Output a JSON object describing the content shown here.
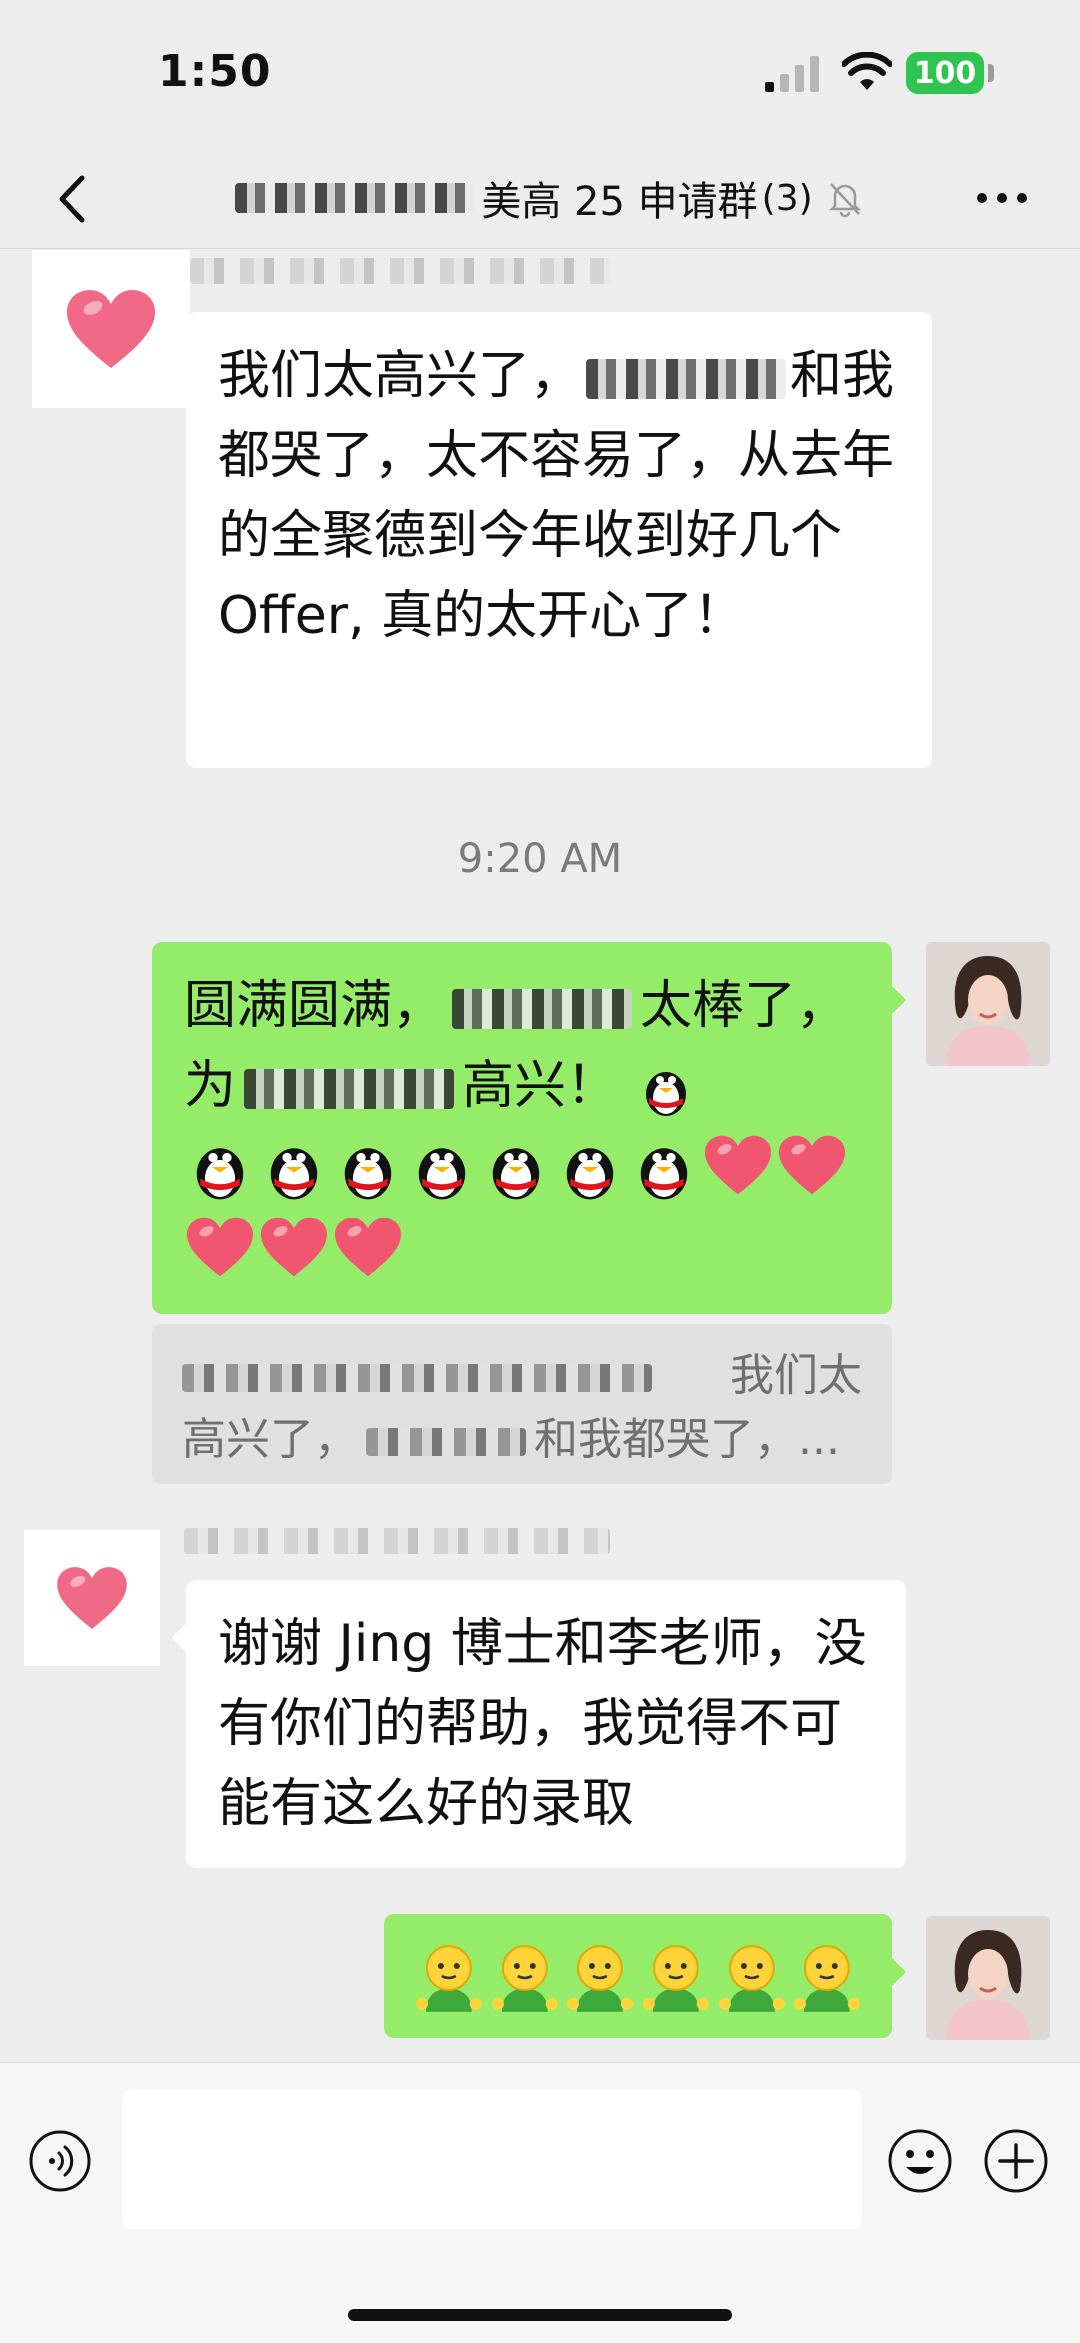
{
  "status_bar": {
    "time": "1:50",
    "battery": "100"
  },
  "header": {
    "title_suffix": "美高 25 申请群",
    "member_count": "(3)"
  },
  "messages": [
    {
      "side": "left",
      "text_a": "我们太高兴了，",
      "text_b": "和我都哭了，太不容易了，从去年的全聚德到今年收到好几个 Offer, 真的太开心了！"
    },
    {
      "timestamp": "9:20 AM"
    },
    {
      "side": "right",
      "text_a": "圆满圆满，",
      "text_b": "太棒了，为",
      "text_c": "高兴！"
    },
    {
      "quote_a": "我们太",
      "quote_b": "高兴了，",
      "quote_c": "和我都哭了，..."
    },
    {
      "side": "left",
      "text": "谢谢 Jing 博士和李老师，没有你们的帮助，我觉得不可能有这么好的录取"
    }
  ],
  "icons": {
    "back": "chevron-left-icon",
    "mute": "bell-slash-icon",
    "more": "more-icon",
    "voice": "voice-icon",
    "emoji": "emoji-icon",
    "plus": "plus-icon"
  },
  "colors": {
    "bubble_self": "#95ec69",
    "bubble_other": "#ffffff",
    "background": "#ededed",
    "battery": "#2fc44f"
  }
}
